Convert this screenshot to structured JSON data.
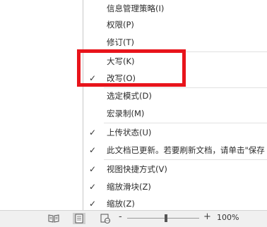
{
  "context_menu": {
    "items": [
      {
        "label": "信息管理策略(I)",
        "checked": false
      },
      {
        "label": "权限(P)",
        "checked": false
      },
      {
        "label": "修订(T)",
        "checked": false
      },
      {
        "label": "大写(K)",
        "checked": false
      },
      {
        "label": "改写(O)",
        "checked": true
      },
      {
        "label": "选定模式(D)",
        "checked": false
      },
      {
        "label": "宏录制(M)",
        "checked": false
      },
      {
        "label": "上传状态(U)",
        "checked": true
      },
      {
        "label": "此文档已更新。若要刷新文档，请单击\"保存",
        "checked": true
      },
      {
        "label": "视图快捷方式(V)",
        "checked": true
      },
      {
        "label": "缩放滑块(Z)",
        "checked": true
      },
      {
        "label": "缩放(Z)",
        "checked": true
      }
    ],
    "check_glyph": "✓"
  },
  "highlight": {
    "color": "#e8141b"
  },
  "statusbar": {
    "zoom_minus": "-",
    "zoom_plus": "+",
    "zoom_percent": "100%"
  },
  "icons": [
    "read-mode-icon",
    "print-layout-icon",
    "web-layout-icon"
  ]
}
